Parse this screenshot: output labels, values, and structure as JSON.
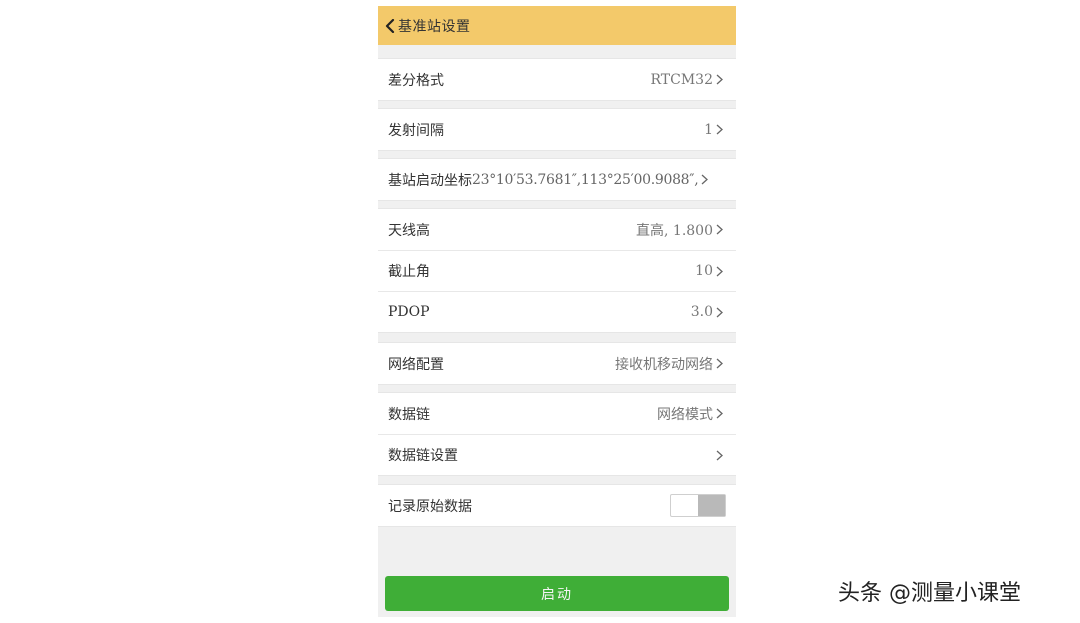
{
  "header": {
    "title": "基准站设置"
  },
  "settings": {
    "diff_format": {
      "label": "差分格式",
      "value": "RTCM32"
    },
    "tx_interval": {
      "label": "发射间隔",
      "value": "1"
    },
    "base_coord": {
      "label": "基站启动坐标",
      "value": "23°10′53.7681″,113°25′00.9088″,"
    },
    "antenna_height": {
      "label": "天线高",
      "value": "直高, 1.800"
    },
    "cutoff_angle": {
      "label": "截止角",
      "value": "10"
    },
    "pdop": {
      "label": "PDOP",
      "value": "3.0"
    },
    "network_config": {
      "label": "网络配置",
      "value": "接收机移动网络"
    },
    "datalink": {
      "label": "数据链",
      "value": "网络模式"
    },
    "datalink_settings": {
      "label": "数据链设置",
      "value": ""
    },
    "record_raw": {
      "label": "记录原始数据",
      "enabled": false
    }
  },
  "actions": {
    "start_label": "启动"
  },
  "watermark": {
    "text": "头条 @测量小课堂"
  },
  "colors": {
    "header": "#f3c96a",
    "start_button": "#3fae37",
    "toggle_off": "#b9b9b9"
  }
}
